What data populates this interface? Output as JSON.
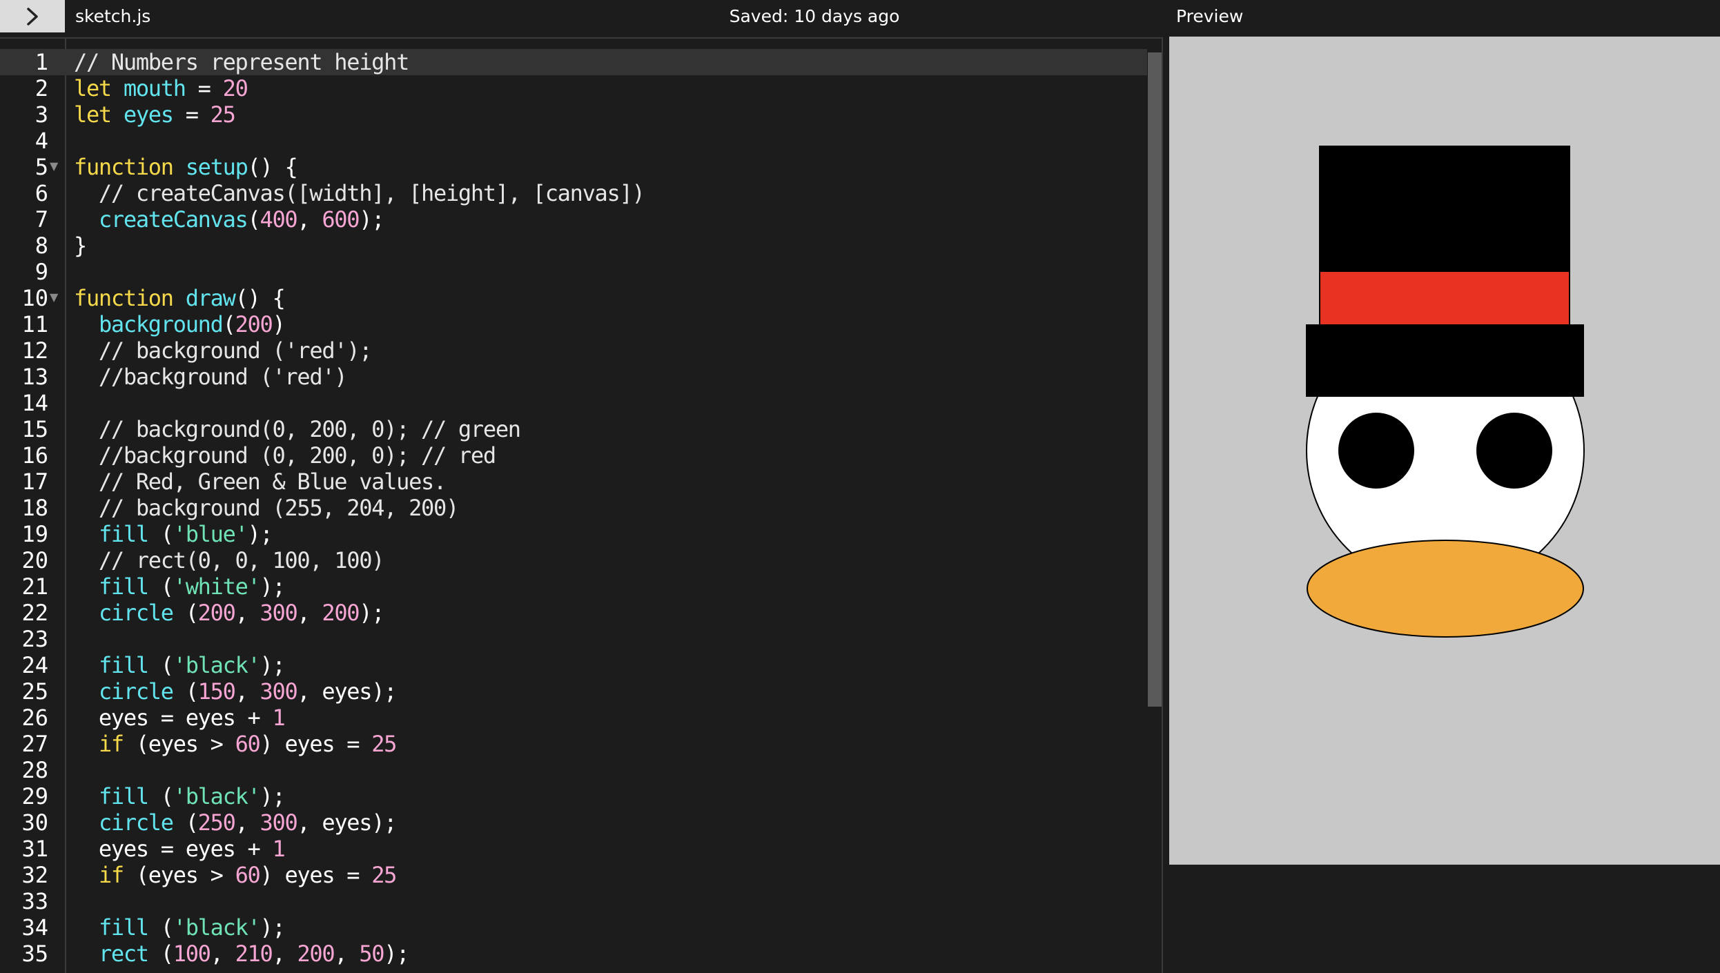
{
  "header": {
    "file_name": "sketch.js",
    "save_status": "Saved: 10 days ago",
    "preview_label": "Preview"
  },
  "editor": {
    "active_line": 1,
    "lines": [
      {
        "n": "1",
        "tokens": [
          {
            "t": "// Numbers represent height",
            "c": "comment"
          }
        ]
      },
      {
        "n": "2",
        "tokens": [
          {
            "t": "let ",
            "c": "keyword"
          },
          {
            "t": "mouth",
            "c": "var"
          },
          {
            "t": " = ",
            "c": "plain"
          },
          {
            "t": "20",
            "c": "num"
          }
        ]
      },
      {
        "n": "3",
        "tokens": [
          {
            "t": "let ",
            "c": "keyword"
          },
          {
            "t": "eyes",
            "c": "var"
          },
          {
            "t": " = ",
            "c": "plain"
          },
          {
            "t": "25",
            "c": "num"
          }
        ]
      },
      {
        "n": "4",
        "tokens": []
      },
      {
        "n": "5",
        "fold": true,
        "tokens": [
          {
            "t": "function ",
            "c": "keyword"
          },
          {
            "t": "setup",
            "c": "var"
          },
          {
            "t": "() {",
            "c": "plain"
          }
        ]
      },
      {
        "n": "6",
        "tokens": [
          {
            "t": "  // createCanvas([width], [height], [canvas])",
            "c": "comment"
          }
        ]
      },
      {
        "n": "7",
        "tokens": [
          {
            "t": "  ",
            "c": "plain"
          },
          {
            "t": "createCanvas",
            "c": "var"
          },
          {
            "t": "(",
            "c": "plain"
          },
          {
            "t": "400",
            "c": "num"
          },
          {
            "t": ", ",
            "c": "plain"
          },
          {
            "t": "600",
            "c": "num"
          },
          {
            "t": ");",
            "c": "plain"
          }
        ]
      },
      {
        "n": "8",
        "tokens": [
          {
            "t": "}",
            "c": "plain"
          }
        ]
      },
      {
        "n": "9",
        "tokens": []
      },
      {
        "n": "10",
        "fold": true,
        "tokens": [
          {
            "t": "function ",
            "c": "keyword"
          },
          {
            "t": "draw",
            "c": "var"
          },
          {
            "t": "() {",
            "c": "plain"
          }
        ]
      },
      {
        "n": "11",
        "tokens": [
          {
            "t": "  ",
            "c": "plain"
          },
          {
            "t": "background",
            "c": "var"
          },
          {
            "t": "(",
            "c": "plain"
          },
          {
            "t": "200",
            "c": "num"
          },
          {
            "t": ")",
            "c": "plain"
          }
        ]
      },
      {
        "n": "12",
        "tokens": [
          {
            "t": "  // background ('red');",
            "c": "comment"
          }
        ]
      },
      {
        "n": "13",
        "tokens": [
          {
            "t": "  //background ('red')",
            "c": "comment"
          }
        ]
      },
      {
        "n": "14",
        "tokens": []
      },
      {
        "n": "15",
        "tokens": [
          {
            "t": "  // background(0, 200, 0); // green",
            "c": "comment"
          }
        ]
      },
      {
        "n": "16",
        "tokens": [
          {
            "t": "  //background (0, 200, 0); // red",
            "c": "comment"
          }
        ]
      },
      {
        "n": "17",
        "tokens": [
          {
            "t": "  // Red, Green & Blue values.",
            "c": "comment"
          }
        ]
      },
      {
        "n": "18",
        "tokens": [
          {
            "t": "  // background (255, 204, 200)",
            "c": "comment"
          }
        ]
      },
      {
        "n": "19",
        "tokens": [
          {
            "t": "  ",
            "c": "plain"
          },
          {
            "t": "fill",
            "c": "var"
          },
          {
            "t": " (",
            "c": "plain"
          },
          {
            "t": "'blue'",
            "c": "str"
          },
          {
            "t": ");",
            "c": "plain"
          }
        ]
      },
      {
        "n": "20",
        "tokens": [
          {
            "t": "  // rect(0, 0, 100, 100)",
            "c": "comment"
          }
        ]
      },
      {
        "n": "21",
        "tokens": [
          {
            "t": "  ",
            "c": "plain"
          },
          {
            "t": "fill",
            "c": "var"
          },
          {
            "t": " (",
            "c": "plain"
          },
          {
            "t": "'white'",
            "c": "str"
          },
          {
            "t": ");",
            "c": "plain"
          }
        ]
      },
      {
        "n": "22",
        "tokens": [
          {
            "t": "  ",
            "c": "plain"
          },
          {
            "t": "circle",
            "c": "var"
          },
          {
            "t": " (",
            "c": "plain"
          },
          {
            "t": "200",
            "c": "num"
          },
          {
            "t": ", ",
            "c": "plain"
          },
          {
            "t": "300",
            "c": "num"
          },
          {
            "t": ", ",
            "c": "plain"
          },
          {
            "t": "200",
            "c": "num"
          },
          {
            "t": ");",
            "c": "plain"
          }
        ]
      },
      {
        "n": "23",
        "tokens": []
      },
      {
        "n": "24",
        "tokens": [
          {
            "t": "  ",
            "c": "plain"
          },
          {
            "t": "fill",
            "c": "var"
          },
          {
            "t": " (",
            "c": "plain"
          },
          {
            "t": "'black'",
            "c": "str"
          },
          {
            "t": ");",
            "c": "plain"
          }
        ]
      },
      {
        "n": "25",
        "tokens": [
          {
            "t": "  ",
            "c": "plain"
          },
          {
            "t": "circle",
            "c": "var"
          },
          {
            "t": " (",
            "c": "plain"
          },
          {
            "t": "150",
            "c": "num"
          },
          {
            "t": ", ",
            "c": "plain"
          },
          {
            "t": "300",
            "c": "num"
          },
          {
            "t": ", eyes);",
            "c": "plain"
          }
        ]
      },
      {
        "n": "26",
        "tokens": [
          {
            "t": "  eyes = eyes + ",
            "c": "plain"
          },
          {
            "t": "1",
            "c": "num"
          }
        ]
      },
      {
        "n": "27",
        "tokens": [
          {
            "t": "  ",
            "c": "plain"
          },
          {
            "t": "if",
            "c": "keyword"
          },
          {
            "t": " (eyes > ",
            "c": "plain"
          },
          {
            "t": "60",
            "c": "num"
          },
          {
            "t": ") eyes = ",
            "c": "plain"
          },
          {
            "t": "25",
            "c": "num"
          }
        ]
      },
      {
        "n": "28",
        "tokens": []
      },
      {
        "n": "29",
        "tokens": [
          {
            "t": "  ",
            "c": "plain"
          },
          {
            "t": "fill",
            "c": "var"
          },
          {
            "t": " (",
            "c": "plain"
          },
          {
            "t": "'black'",
            "c": "str"
          },
          {
            "t": ");",
            "c": "plain"
          }
        ]
      },
      {
        "n": "30",
        "tokens": [
          {
            "t": "  ",
            "c": "plain"
          },
          {
            "t": "circle",
            "c": "var"
          },
          {
            "t": " (",
            "c": "plain"
          },
          {
            "t": "250",
            "c": "num"
          },
          {
            "t": ", ",
            "c": "plain"
          },
          {
            "t": "300",
            "c": "num"
          },
          {
            "t": ", eyes);",
            "c": "plain"
          }
        ]
      },
      {
        "n": "31",
        "tokens": [
          {
            "t": "  eyes = eyes + ",
            "c": "plain"
          },
          {
            "t": "1",
            "c": "num"
          }
        ]
      },
      {
        "n": "32",
        "tokens": [
          {
            "t": "  ",
            "c": "plain"
          },
          {
            "t": "if",
            "c": "keyword"
          },
          {
            "t": " (eyes > ",
            "c": "plain"
          },
          {
            "t": "60",
            "c": "num"
          },
          {
            "t": ") eyes = ",
            "c": "plain"
          },
          {
            "t": "25",
            "c": "num"
          }
        ]
      },
      {
        "n": "33",
        "tokens": []
      },
      {
        "n": "34",
        "tokens": [
          {
            "t": "  ",
            "c": "plain"
          },
          {
            "t": "fill",
            "c": "var"
          },
          {
            "t": " (",
            "c": "plain"
          },
          {
            "t": "'black'",
            "c": "str"
          },
          {
            "t": ");",
            "c": "plain"
          }
        ]
      },
      {
        "n": "35",
        "tokens": [
          {
            "t": "  ",
            "c": "plain"
          },
          {
            "t": "rect",
            "c": "var"
          },
          {
            "t": " (",
            "c": "plain"
          },
          {
            "t": "100",
            "c": "num"
          },
          {
            "t": ", ",
            "c": "plain"
          },
          {
            "t": "210",
            "c": "num"
          },
          {
            "t": ", ",
            "c": "plain"
          },
          {
            "t": "200",
            "c": "num"
          },
          {
            "t": ", ",
            "c": "plain"
          },
          {
            "t": "50",
            "c": "num"
          },
          {
            "t": ");",
            "c": "plain"
          }
        ]
      }
    ]
  },
  "icons": {
    "toggle": "chevron-right-icon",
    "fold": "fold-triangle-icon"
  },
  "colors": {
    "comment": "#e6e6e6",
    "keyword": "#f5d94a",
    "var": "#62e4ee",
    "num": "#f7a6d4",
    "str": "#6fe3b5",
    "plain": "#ffffff",
    "preview_background": "#c8c8c8",
    "hat": "#000000",
    "hat_band": "#e83323",
    "face": "#ffffff",
    "eyes": "#000000",
    "beak": "#f0a93a"
  }
}
